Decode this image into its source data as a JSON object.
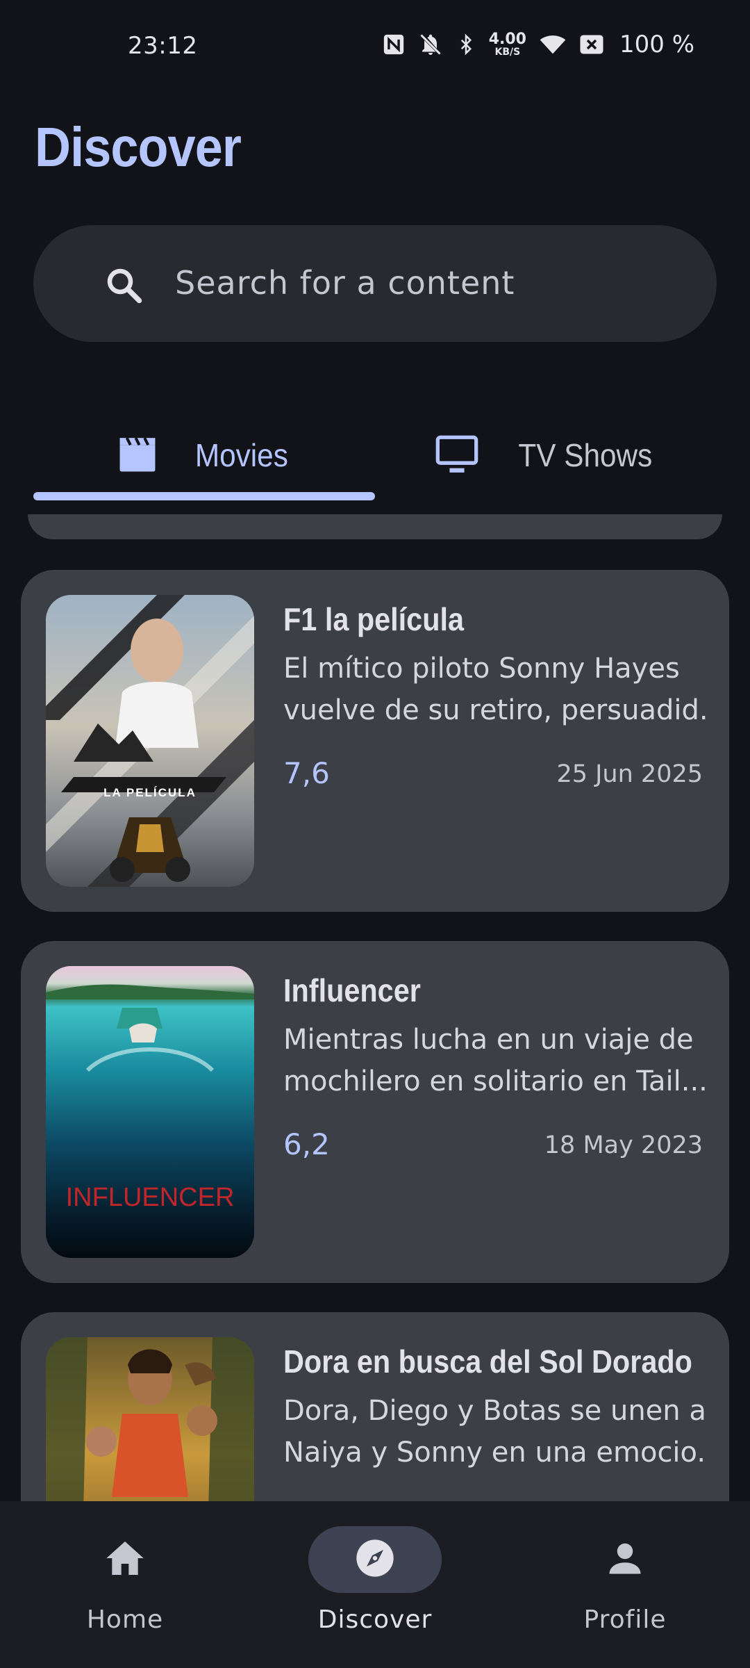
{
  "status_bar": {
    "time": "23:12",
    "speed_value": "4.00",
    "speed_unit": "KB/S",
    "battery": "100 %"
  },
  "page": {
    "title": "Discover"
  },
  "search": {
    "placeholder": "Search for a content"
  },
  "tabs": [
    {
      "label": "Movies",
      "icon": "clapperboard-icon",
      "selected": true
    },
    {
      "label": "TV Shows",
      "icon": "tv-icon",
      "selected": false
    }
  ],
  "movies": [
    {
      "title": "F1 la película",
      "desc_line1": "El mítico piloto Sonny Hayes",
      "desc_line2": "vuelve de su retiro, persuadid...",
      "rating": "7,6",
      "date": "25 Jun 2025",
      "poster_caption": "LA PELÍCULA"
    },
    {
      "title": "Influencer",
      "desc_line1": "Mientras lucha en un viaje de",
      "desc_line2": "mochilero en solitario en Tail...",
      "rating": "6,2",
      "date": "18 May 2023",
      "poster_caption": "INFLUENCER"
    },
    {
      "title": "Dora en busca del Sol Dorado",
      "desc_line1": "Dora, Diego y Botas se unen a",
      "desc_line2": "Naiya y Sonny en una emocio...",
      "rating": "",
      "date": ""
    }
  ],
  "nav": [
    {
      "label": "Home",
      "icon": "home-icon",
      "active": false
    },
    {
      "label": "Discover",
      "icon": "compass-icon",
      "active": true
    },
    {
      "label": "Profile",
      "icon": "person-icon",
      "active": false
    }
  ],
  "colors": {
    "accent": "#b4c5ff",
    "background": "#121318",
    "card": "#3d3f47",
    "search": "#292a2f",
    "nav": "#1c1d23"
  }
}
